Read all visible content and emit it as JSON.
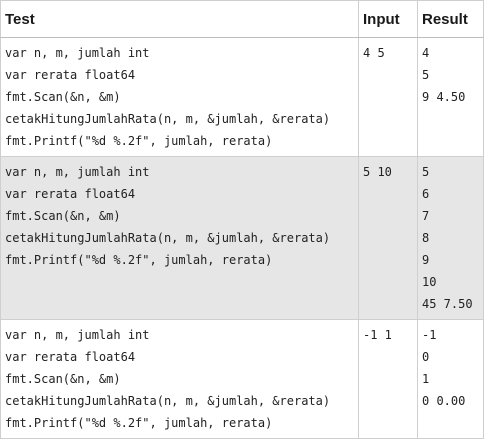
{
  "headers": {
    "test": "Test",
    "input": "Input",
    "result": "Result"
  },
  "rows": [
    {
      "test": [
        "var n, m, jumlah int",
        "var rerata float64",
        "fmt.Scan(&n, &m)",
        "cetakHitungJumlahRata(n, m, &jumlah, &rerata)",
        "fmt.Printf(\"%d %.2f\", jumlah, rerata)"
      ],
      "input": "4 5",
      "result": [
        "4",
        "5",
        "9 4.50"
      ]
    },
    {
      "test": [
        "var n, m, jumlah int",
        "var rerata float64",
        "fmt.Scan(&n, &m)",
        "cetakHitungJumlahRata(n, m, &jumlah, &rerata)",
        "fmt.Printf(\"%d %.2f\", jumlah, rerata)"
      ],
      "input": "5 10",
      "result": [
        "5",
        "6",
        "7",
        "8",
        "9",
        "10",
        "45 7.50"
      ]
    },
    {
      "test": [
        "var n, m, jumlah int",
        "var rerata float64",
        "fmt.Scan(&n, &m)",
        "cetakHitungJumlahRata(n, m, &jumlah, &rerata)",
        "fmt.Printf(\"%d %.2f\", jumlah, rerata)"
      ],
      "input": "-1 1",
      "result": [
        "-1",
        "0",
        "1",
        "0 0.00"
      ]
    }
  ]
}
